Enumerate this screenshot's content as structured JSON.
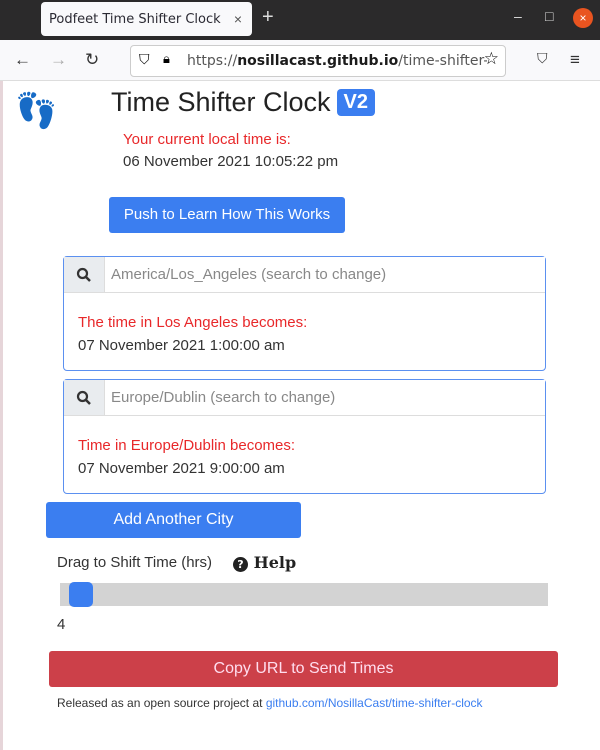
{
  "browser": {
    "tab_title": "Podfeet Time Shifter Clock",
    "tab_close": "×",
    "new_tab": "+",
    "url_prefix": "https://",
    "url_domain": "nosillacast.github.io",
    "url_path": "/time-shifter-clock",
    "window_minimize": "–",
    "window_maximize": "□",
    "window_close": "×"
  },
  "header": {
    "logo_icon": "👣",
    "title": "Time Shifter Clock",
    "badge": "V2",
    "local_label": "Your current local time is:",
    "local_time": "06 November 2021 10:05:22 pm",
    "learn_button": "Push to Learn How This Works"
  },
  "cities": [
    {
      "placeholder": "America/Los_Angeles (search to change)",
      "label": "The time in Los Angeles becomes:",
      "time": "07 November 2021 1:00:00 am"
    },
    {
      "placeholder": "Europe/Dublin (search to change)",
      "label": "Time in Europe/Dublin becomes:",
      "time": "07 November 2021 9:00:00 am"
    }
  ],
  "controls": {
    "add_city": "Add Another City",
    "slider_label": "Drag to Shift Time (hrs)",
    "help_icon": "?",
    "help_label": "Help",
    "slider_value": "4",
    "copy_url": "Copy URL to Send Times"
  },
  "footer": {
    "text": "Released as an open source project at ",
    "link": "github.com/NosillaCast/time-shifter-clock"
  }
}
